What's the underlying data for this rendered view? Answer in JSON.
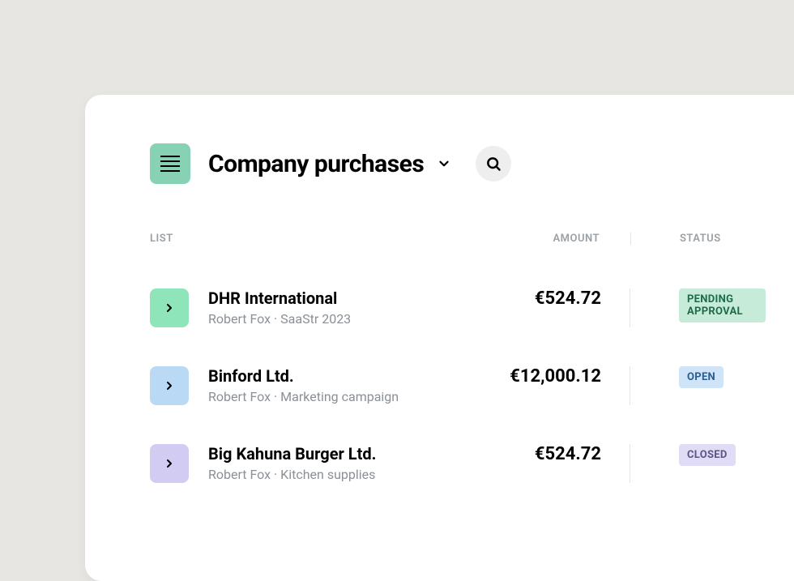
{
  "header": {
    "title": "Company purchases"
  },
  "columns": {
    "list": "LIST",
    "amount": "AMOUNT",
    "status": "STATUS"
  },
  "items": [
    {
      "name": "DHR International",
      "person": "Robert Fox",
      "project": "SaaStr 2023",
      "amount": "€524.72",
      "status": "PENDING APPROVAL",
      "icon_variant": "green",
      "badge_variant": "pending"
    },
    {
      "name": "Binford Ltd.",
      "person": "Robert Fox",
      "project": "Marketing campaign",
      "amount": "€12,000.12",
      "status": "OPEN",
      "icon_variant": "blue",
      "badge_variant": "open"
    },
    {
      "name": "Big Kahuna Burger Ltd.",
      "person": "Robert Fox",
      "project": "Kitchen supplies",
      "amount": "€524.72",
      "status": "CLOSED",
      "icon_variant": "purple",
      "badge_variant": "closed"
    }
  ]
}
